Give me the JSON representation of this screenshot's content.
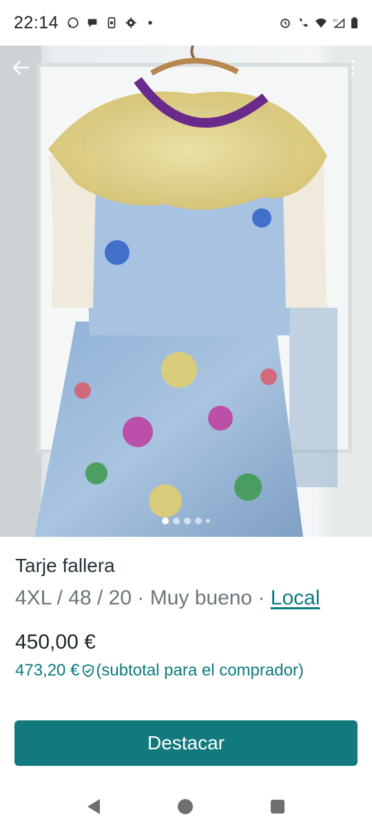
{
  "status_bar": {
    "time": "22:14",
    "left_icons": [
      "whatsapp-icon",
      "chat-icon",
      "phone-sync-icon",
      "settings-icon",
      "dot-icon"
    ],
    "right_icons": [
      "alarm-icon",
      "wifi-call-icon",
      "wifi-icon",
      "signal-4g-icon",
      "battery-icon"
    ],
    "network": "4G"
  },
  "photo": {
    "alt_subject": "dress-photo",
    "carousel": {
      "total": 5,
      "active_index": 0
    }
  },
  "listing": {
    "title": "Tarje fallera",
    "size": "4XL / 48 / 20",
    "separator": " · ",
    "condition": "Muy bueno",
    "location_link": "Local",
    "price": "450,00 €",
    "buyer_price": "473,20 €",
    "buyer_note": "(subtotal para el comprador)"
  },
  "cta": {
    "label": "Destacar"
  },
  "colors": {
    "accent": "#12797c",
    "link": "#0b7a7f",
    "text": "#253238",
    "muted": "#6a757a"
  }
}
